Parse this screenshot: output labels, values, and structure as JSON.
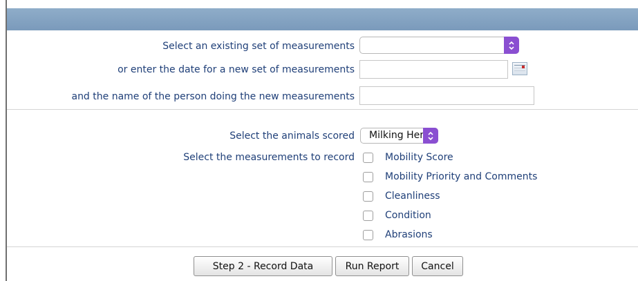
{
  "form": {
    "existing_label": "Select an existing set of measurements",
    "existing_value": "",
    "date_label": "or enter the date for a new set of measurements",
    "date_value": "",
    "person_label": "and the name of the person doing the new measurements",
    "person_value": ""
  },
  "animals": {
    "label": "Select the animals scored",
    "selected": "Milking Herd"
  },
  "measurements": {
    "label": "Select the measurements to record",
    "items": [
      {
        "label": "Mobility Score",
        "checked": false
      },
      {
        "label": "Mobility Priority and Comments",
        "checked": false
      },
      {
        "label": "Cleanliness",
        "checked": false
      },
      {
        "label": "Condition",
        "checked": false
      },
      {
        "label": "Abrasions",
        "checked": false
      }
    ]
  },
  "buttons": {
    "step2": "Step 2 - Record Data",
    "report": "Run Report",
    "cancel": "Cancel"
  },
  "icons": {
    "stepper": "select-stepper-icon",
    "calendar": "calendar-icon"
  },
  "colors": {
    "header_bar": "#7a9abb",
    "label_text": "#1f3f78",
    "stepper_purple": "#8a4fd1"
  }
}
